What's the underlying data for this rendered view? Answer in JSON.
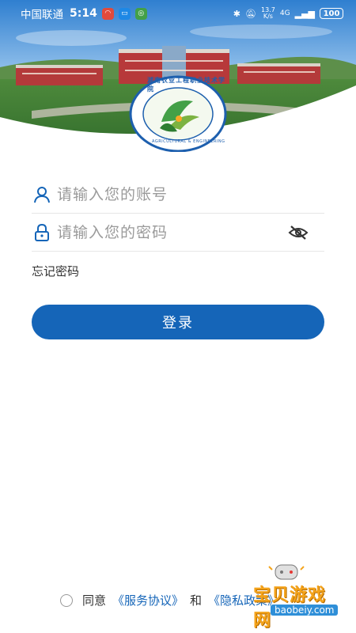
{
  "status_bar": {
    "carrier": "中国联通",
    "time": "5:14",
    "network": "13.7 K/s",
    "signal": "4G",
    "battery": "100"
  },
  "logo": {
    "text_top": "湖南农业工程职业技术学院",
    "text_bottom": "AGRICULTURAL & ENGINEERING"
  },
  "login": {
    "account_placeholder": "请输入您的账号",
    "password_placeholder": "请输入您的密码",
    "forgot_label": "忘记密码",
    "login_button": "登录"
  },
  "agreement": {
    "prefix": "同意",
    "service_link": "《服务协议》",
    "conjunction": "和",
    "privacy_link": "《隐私政策》"
  },
  "watermark": {
    "text": "宝贝游戏网",
    "url": "baobeiy.com"
  },
  "colors": {
    "primary": "#1565b8",
    "placeholder": "#9a9a9a"
  }
}
